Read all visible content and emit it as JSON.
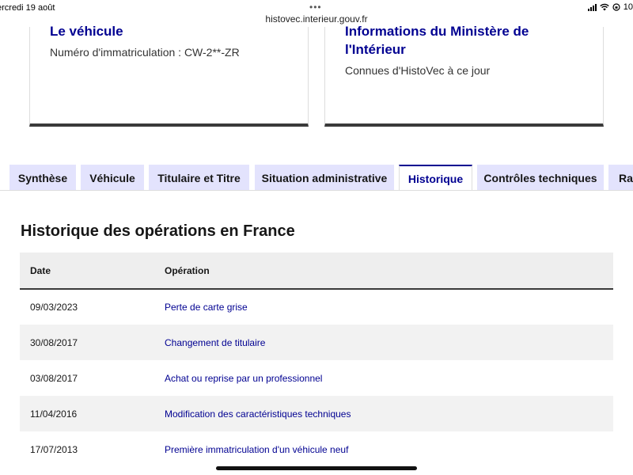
{
  "status_bar": {
    "date": "ercredi 19 août",
    "dots": "•••",
    "url": "histovec.interieur.gouv.fr",
    "battery": "10"
  },
  "cards": {
    "vehicle": {
      "title": "Le véhicule",
      "text": "Numéro d'immatriculation : CW-2**-ZR"
    },
    "ministry": {
      "title_line1": "Informations du Ministère de",
      "title_line2": "l'Intérieur",
      "text": "Connues d'HistoVec à ce jour"
    }
  },
  "tabs": [
    {
      "label": "Synthèse"
    },
    {
      "label": "Véhicule"
    },
    {
      "label": "Titulaire et Titre"
    },
    {
      "label": "Situation administrative"
    },
    {
      "label": "Historique",
      "active": true
    },
    {
      "label": "Contrôles techniques"
    },
    {
      "label": "Rap"
    }
  ],
  "history": {
    "title": "Historique des opérations en France",
    "columns": {
      "date": "Date",
      "operation": "Opération"
    },
    "rows": [
      {
        "date": "09/03/2023",
        "operation": "Perte de carte grise"
      },
      {
        "date": "30/08/2017",
        "operation": "Changement de titulaire"
      },
      {
        "date": "03/08/2017",
        "operation": "Achat ou reprise par un professionnel"
      },
      {
        "date": "11/04/2016",
        "operation": "Modification des caractéristiques techniques"
      },
      {
        "date": "17/07/2013",
        "operation": "Première immatriculation d'un véhicule neuf"
      }
    ]
  },
  "colors": {
    "accent": "#000091",
    "tab_bg": "#e3e3fd",
    "row_alt": "#f2f2f2",
    "header_bg": "#eeeeee"
  }
}
